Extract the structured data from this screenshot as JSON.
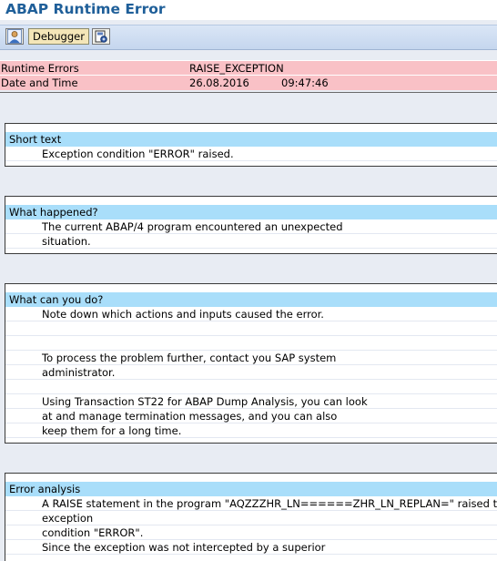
{
  "window": {
    "title": "ABAP Runtime Error"
  },
  "toolbar": {
    "buttons": [
      {
        "icon": "person-icon"
      },
      {
        "label": "Debugger"
      },
      {
        "icon": "save-local-icon"
      }
    ]
  },
  "header": {
    "runtime_errors_label": "Runtime Errors",
    "runtime_errors_value": "RAISE_EXCEPTION",
    "date_time_label": "Date and Time",
    "date_value": "26.08.2016",
    "time_value": "09:47:46"
  },
  "sections": [
    {
      "heading": "Short text",
      "lines": [
        "Exception condition \"ERROR\" raised."
      ]
    },
    {
      "heading": "What happened?",
      "lines": [
        "The current ABAP/4 program encountered an unexpected",
        "situation."
      ]
    },
    {
      "heading": "What can you do?",
      "lines": [
        "Note down which actions and inputs caused the error.",
        "",
        "",
        "To process the problem further, contact you SAP system",
        "administrator.",
        "",
        "Using Transaction ST22 for ABAP Dump Analysis, you can look",
        "at and manage termination messages, and you can also",
        "keep them for a long time."
      ]
    },
    {
      "heading": "Error analysis",
      "lines": [
        "A RAISE statement in the program \"AQZZZHR_LN======ZHR_LN_REPLAN=\" raised the",
        " exception",
        "condition \"ERROR\".",
        "Since the exception was not intercepted by a superior"
      ]
    }
  ],
  "colors": {
    "title": "#1f5f99",
    "header_band": "#f9c1c6",
    "section_heading": "#a9defa",
    "background": "#e8ecf3"
  }
}
